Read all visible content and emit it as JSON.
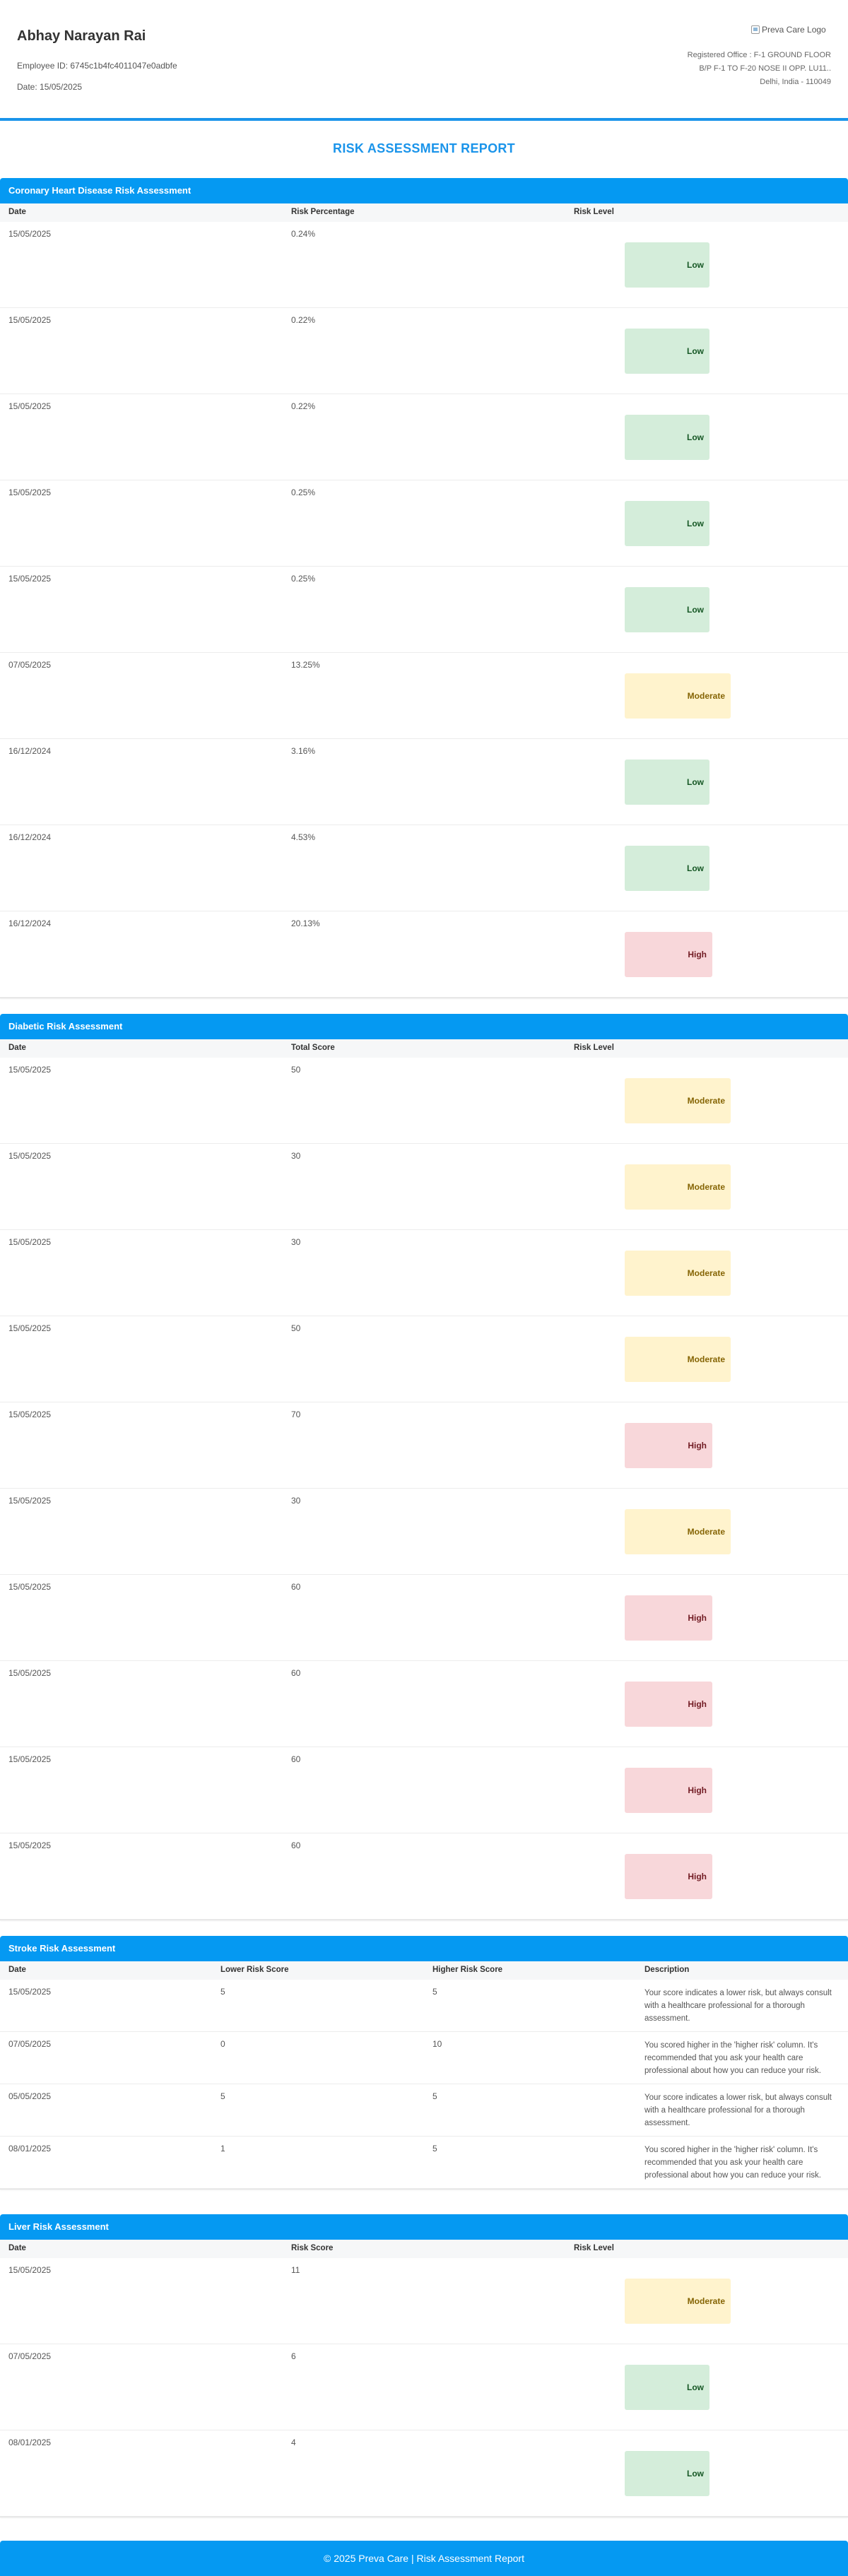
{
  "employee": {
    "name": "Abhay Narayan Rai",
    "id_text": "Employee ID: 6745c1b4fc4011047e0adbfe",
    "date_text": "Date: 15/05/2025"
  },
  "company": {
    "logo_alt": "Preva Care Logo",
    "address_lines": [
      "Registered Office : F-1 GROUND FLOOR",
      "B/P F-1 TO F-20 NOSE II OPP. LU11..",
      "Delhi, India - 110049"
    ]
  },
  "report_title": "RISK ASSESSMENT REPORT",
  "colors": {
    "accent": "#0599f2",
    "low": "#d4edda",
    "moderate": "#fff3cd",
    "high": "#f8d7da"
  },
  "sections": [
    {
      "key": "chd",
      "title": "Coronary Heart Disease Risk Assessment",
      "columns": [
        "Date",
        "Risk Percentage",
        "Risk Level"
      ],
      "rows": [
        {
          "date": "15/05/2025",
          "value": "0.24%",
          "level": "Low"
        },
        {
          "date": "15/05/2025",
          "value": "0.22%",
          "level": "Low"
        },
        {
          "date": "15/05/2025",
          "value": "0.22%",
          "level": "Low"
        },
        {
          "date": "15/05/2025",
          "value": "0.25%",
          "level": "Low"
        },
        {
          "date": "15/05/2025",
          "value": "0.25%",
          "level": "Low"
        },
        {
          "date": "07/05/2025",
          "value": "13.25%",
          "level": "Moderate"
        },
        {
          "date": "16/12/2024",
          "value": "3.16%",
          "level": "Low"
        },
        {
          "date": "16/12/2024",
          "value": "4.53%",
          "level": "Low"
        },
        {
          "date": "16/12/2024",
          "value": "20.13%",
          "level": "High"
        }
      ]
    },
    {
      "key": "diabetic",
      "title": "Diabetic Risk Assessment",
      "columns": [
        "Date",
        "Total Score",
        "Risk Level"
      ],
      "rows": [
        {
          "date": "15/05/2025",
          "value": "50",
          "level": "Moderate"
        },
        {
          "date": "15/05/2025",
          "value": "30",
          "level": "Moderate"
        },
        {
          "date": "15/05/2025",
          "value": "30",
          "level": "Moderate"
        },
        {
          "date": "15/05/2025",
          "value": "50",
          "level": "Moderate"
        },
        {
          "date": "15/05/2025",
          "value": "70",
          "level": "High"
        },
        {
          "date": "15/05/2025",
          "value": "30",
          "level": "Moderate"
        },
        {
          "date": "15/05/2025",
          "value": "60",
          "level": "High"
        },
        {
          "date": "15/05/2025",
          "value": "60",
          "level": "High"
        },
        {
          "date": "15/05/2025",
          "value": "60",
          "level": "High"
        },
        {
          "date": "15/05/2025",
          "value": "60",
          "level": "High"
        }
      ]
    },
    {
      "key": "stroke",
      "title": "Stroke Risk Assessment",
      "columns": [
        "Date",
        "Lower Risk Score",
        "Higher Risk Score",
        "Description"
      ],
      "rows": [
        {
          "date": "15/05/2025",
          "lower": "5",
          "higher": "5",
          "description": "Your score indicates a lower risk, but always consult with a healthcare professional for a thorough assessment."
        },
        {
          "date": "07/05/2025",
          "lower": "0",
          "higher": "10",
          "description": "You scored higher in the 'higher risk' column. It's recommended that you ask your health care professional about how you can reduce your risk."
        },
        {
          "date": "05/05/2025",
          "lower": "5",
          "higher": "5",
          "description": "Your score indicates a lower risk, but always consult with a healthcare professional for a thorough assessment."
        },
        {
          "date": "08/01/2025",
          "lower": "1",
          "higher": "5",
          "description": "You scored higher in the 'higher risk' column. It's recommended that you ask your health care professional about how you can reduce your risk."
        }
      ]
    },
    {
      "key": "liver",
      "title": "Liver Risk Assessment",
      "columns": [
        "Date",
        "Risk Score",
        "Risk Level"
      ],
      "rows": [
        {
          "date": "15/05/2025",
          "value": "11",
          "level": "Moderate"
        },
        {
          "date": "07/05/2025",
          "value": "6",
          "level": "Low"
        },
        {
          "date": "08/01/2025",
          "value": "4",
          "level": "Low"
        }
      ]
    }
  ],
  "footer": "© 2025 Preva Care | Risk Assessment Report"
}
